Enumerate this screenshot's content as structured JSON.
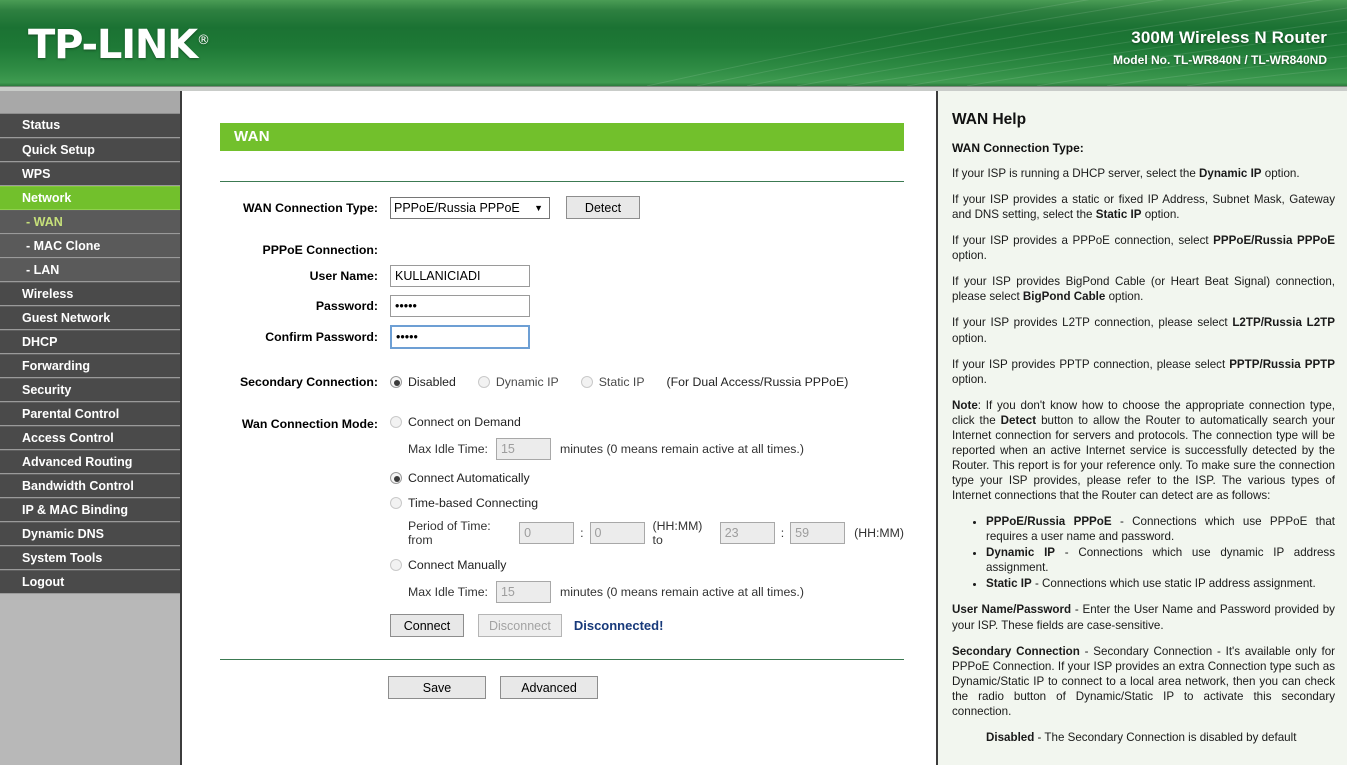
{
  "header": {
    "brand": "TP-LINK",
    "brand_reg": "®",
    "product": "300M Wireless N Router",
    "model": "Model No. TL-WR840N / TL-WR840ND",
    "brand_color": "#1b7233",
    "accent_color": "#72c02c"
  },
  "sidebar": {
    "items": [
      {
        "label": "Status",
        "type": "main",
        "state": "normal"
      },
      {
        "label": "Quick Setup",
        "type": "main",
        "state": "normal"
      },
      {
        "label": "WPS",
        "type": "main",
        "state": "normal"
      },
      {
        "label": "Network",
        "type": "main",
        "state": "active"
      },
      {
        "label": "- WAN",
        "type": "sub",
        "state": "selected"
      },
      {
        "label": "- MAC Clone",
        "type": "sub",
        "state": "normal"
      },
      {
        "label": "- LAN",
        "type": "sub",
        "state": "normal"
      },
      {
        "label": "Wireless",
        "type": "main",
        "state": "normal"
      },
      {
        "label": "Guest Network",
        "type": "main",
        "state": "normal"
      },
      {
        "label": "DHCP",
        "type": "main",
        "state": "normal"
      },
      {
        "label": "Forwarding",
        "type": "main",
        "state": "normal"
      },
      {
        "label": "Security",
        "type": "main",
        "state": "normal"
      },
      {
        "label": "Parental Control",
        "type": "main",
        "state": "normal"
      },
      {
        "label": "Access Control",
        "type": "main",
        "state": "normal"
      },
      {
        "label": "Advanced Routing",
        "type": "main",
        "state": "normal"
      },
      {
        "label": "Bandwidth Control",
        "type": "main",
        "state": "normal"
      },
      {
        "label": "IP & MAC Binding",
        "type": "main",
        "state": "normal"
      },
      {
        "label": "Dynamic DNS",
        "type": "main",
        "state": "normal"
      },
      {
        "label": "System Tools",
        "type": "main",
        "state": "normal"
      },
      {
        "label": "Logout",
        "type": "main",
        "state": "normal"
      }
    ]
  },
  "main": {
    "section_title": "WAN",
    "wan_type": {
      "label": "WAN Connection Type:",
      "value": "PPPoE/Russia PPPoE",
      "caret": "▼",
      "detect_button": "Detect",
      "options": [
        "Dynamic IP",
        "Static IP",
        "PPPoE/Russia PPPoE",
        "BigPond Cable",
        "L2TP/Russia L2TP",
        "PPTP/Russia PPTP"
      ]
    },
    "pppoe": {
      "heading": "PPPoE Connection:",
      "user_name_label": "User Name:",
      "user_name_value": "KULLANICIADI",
      "password_label": "Password:",
      "password_value": "•••••",
      "confirm_label": "Confirm Password:",
      "confirm_value": "•••••"
    },
    "secondary": {
      "label": "Secondary Connection:",
      "options": [
        {
          "label": "Disabled",
          "checked": true,
          "dim": false
        },
        {
          "label": "Dynamic IP",
          "checked": false,
          "dim": true
        },
        {
          "label": "Static IP",
          "checked": false,
          "dim": true
        }
      ],
      "note": "(For Dual Access/Russia PPPoE)"
    },
    "mode": {
      "label": "Wan Connection Mode:",
      "connect_on_demand": {
        "label": "Connect on Demand",
        "checked": false
      },
      "demand_idle": {
        "label": "Max Idle Time:",
        "value": "15",
        "suffix": "minutes (0 means remain active at all times.)"
      },
      "connect_automatically": {
        "label": "Connect Automatically",
        "checked": true
      },
      "time_based": {
        "label": "Time-based Connecting",
        "checked": false
      },
      "period": {
        "label": "Period of Time: from",
        "from_hh": "0",
        "from_mm": "0",
        "mid_label": "(HH:MM) to",
        "to_hh": "23",
        "to_mm": "59",
        "end_label": "(HH:MM)",
        "colon": ":"
      },
      "connect_manually": {
        "label": "Connect Manually",
        "checked": false
      },
      "manual_idle": {
        "label": "Max Idle Time:",
        "value": "15",
        "suffix": "minutes (0 means remain active at all times.)"
      },
      "connect_button": "Connect",
      "disconnect_button": "Disconnect",
      "status": "Disconnected!",
      "status_color": "#17397a"
    },
    "footer": {
      "save_button": "Save",
      "advanced_button": "Advanced"
    }
  },
  "help": {
    "title": "WAN Help",
    "subhead": "WAN Connection Type:",
    "p1_a": "If your ISP is running a DHCP server, select the ",
    "p1_b": "Dynamic IP",
    "p1_c": " option.",
    "p2_a": "If your ISP provides a static or fixed IP Address, Subnet Mask, Gateway and DNS setting, select the ",
    "p2_b": "Static IP",
    "p2_c": " option.",
    "p3_a": "If your ISP provides a PPPoE connection, select ",
    "p3_b": "PPPoE/Russia PPPoE",
    "p3_c": " option.",
    "p4_a": "If your ISP provides BigPond Cable (or Heart Beat Signal) connection, please select ",
    "p4_b": "BigPond Cable",
    "p4_c": " option.",
    "p5_a": "If your ISP provides L2TP connection, please select ",
    "p5_b": "L2TP/Russia L2TP",
    "p5_c": " option.",
    "p6_a": "If your ISP provides PPTP connection, please select ",
    "p6_b": "PPTP/Russia PPTP",
    "p6_c": " option.",
    "note_label": "Note",
    "note_a": ": If you don't know how to choose the appropriate connection type, click the ",
    "note_b": "Detect",
    "note_c": " button to allow the Router to automatically search your Internet connection for servers and protocols. The connection type will be reported when an active Internet service is successfully detected by the Router. This report is for your reference only. To make sure the connection type your ISP provides, please refer to the ISP. The various types of Internet connections that the Router can detect are as follows:",
    "bullets": [
      {
        "term": "PPPoE/Russia PPPoE",
        "text": " - Connections which use PPPoE that requires a user name and password."
      },
      {
        "term": "Dynamic IP",
        "text": " - Connections which use dynamic IP address assignment."
      },
      {
        "term": "Static IP",
        "text": " - Connections which use static IP address assignment."
      }
    ],
    "p7_b": "User Name/Password",
    "p7_t": " - Enter the User Name and Password provided by your ISP. These fields are case-sensitive.",
    "p8_b": "Secondary Connection",
    "p8_t": " - Secondary Connection - It's available only for PPPoE Connection. If your ISP provides an extra Connection type such as Dynamic/Static IP to connect to a local area network, then you can check the radio button of Dynamic/Static IP to activate this secondary connection.",
    "p9_b": "Disabled",
    "p9_t": " - The Secondary Connection is disabled by default"
  }
}
